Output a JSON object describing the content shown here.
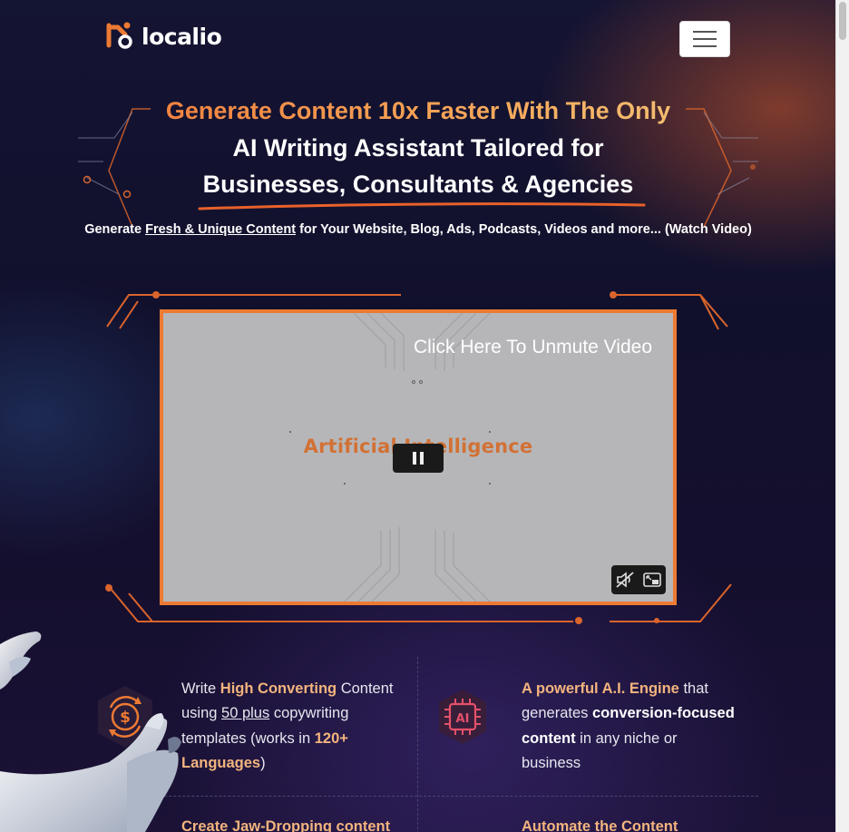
{
  "header": {
    "logo_text": "localio",
    "menu_icon": "hamburger-icon"
  },
  "hero": {
    "title_line1": "Generate Content 10x Faster With The Only",
    "title_line2": "AI Writing Assistant Tailored for",
    "title_line3": "Businesses, Consultants & Agencies",
    "subtitle_pre": "Generate ",
    "subtitle_link": "Fresh & Unique Content",
    "subtitle_post": " for Your Website, Blog, Ads, Podcasts, Videos and more... (Watch Video)"
  },
  "video": {
    "unmute_text": "Click Here To Unmute Video",
    "frame_text": "Artificial Intelligence",
    "pause_icon": "pause-icon",
    "mute_icon": "speaker-muted-icon",
    "pip_icon": "picture-in-picture-icon"
  },
  "features": [
    {
      "icon": "dollar-cycle-icon",
      "t1": "Write ",
      "t2": "High Converting",
      "t3": "Content using ",
      "t4": "50 plus",
      "t5": " copywriting templates (works in ",
      "t6": "120+ Languages",
      "t7": ")"
    },
    {
      "icon": "ai-chip-icon",
      "t1": "A powerful A.I. Engine",
      "t2": " that generates ",
      "t3": "conversion-focused content",
      "t4": " in any niche or business"
    },
    {
      "t1": "Create Jaw-Dropping content"
    },
    {
      "t1": "Automate the Content"
    }
  ],
  "colors": {
    "accent": "#ec7a33",
    "accent_light": "#f3b47e",
    "background": "#141433"
  }
}
